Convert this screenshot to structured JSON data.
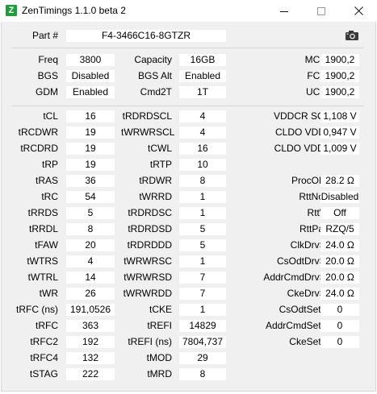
{
  "window": {
    "title": "ZenTimings 1.1.0 beta 2",
    "icon_letter": "Z",
    "icon_color": "#1e9e3a"
  },
  "part": {
    "label": "Part #",
    "value": "F4-3466C16-8GTZR"
  },
  "top_rows": [
    [
      {
        "label": "Freq",
        "value": "3800"
      },
      {
        "label": "Capacity",
        "value": "16GB"
      },
      {
        "label": "MCLK",
        "value": "1900,2"
      }
    ],
    [
      {
        "label": "BGS",
        "value": "Disabled"
      },
      {
        "label": "BGS Alt",
        "value": "Enabled"
      },
      {
        "label": "FCLK",
        "value": "1900,2"
      }
    ],
    [
      {
        "label": "GDM",
        "value": "Enabled"
      },
      {
        "label": "Cmd2T",
        "value": "1T"
      },
      {
        "label": "UCLK",
        "value": "1900,2"
      }
    ]
  ],
  "col1": [
    {
      "label": "tCL",
      "value": "16"
    },
    {
      "label": "tRCDWR",
      "value": "19"
    },
    {
      "label": "tRCDRD",
      "value": "19"
    },
    {
      "label": "tRP",
      "value": "19"
    },
    {
      "label": "tRAS",
      "value": "36"
    },
    {
      "label": "tRC",
      "value": "54"
    },
    {
      "label": "tRRDS",
      "value": "5"
    },
    {
      "label": "tRRDL",
      "value": "8"
    },
    {
      "label": "tFAW",
      "value": "20"
    },
    {
      "label": "tWTRS",
      "value": "4"
    },
    {
      "label": "tWTRL",
      "value": "14"
    },
    {
      "label": "tWR",
      "value": "26"
    },
    {
      "label": "tRFC (ns)",
      "value": "191,0526"
    },
    {
      "label": "tRFC",
      "value": "363"
    },
    {
      "label": "tRFC2",
      "value": "192"
    },
    {
      "label": "tRFC4",
      "value": "132"
    },
    {
      "label": "tSTAG",
      "value": "222"
    }
  ],
  "col2": [
    {
      "label": "tRDRDSCL",
      "value": "4"
    },
    {
      "label": "tWRWRSCL",
      "value": "4"
    },
    {
      "label": "tCWL",
      "value": "16"
    },
    {
      "label": "tRTP",
      "value": "10"
    },
    {
      "label": "tRDWR",
      "value": "8"
    },
    {
      "label": "tWRRD",
      "value": "1"
    },
    {
      "label": "tRDRDSC",
      "value": "1"
    },
    {
      "label": "tRDRDSD",
      "value": "5"
    },
    {
      "label": "tRDRDDD",
      "value": "5"
    },
    {
      "label": "tWRWRSC",
      "value": "1"
    },
    {
      "label": "tWRWRSD",
      "value": "7"
    },
    {
      "label": "tWRWRDD",
      "value": "7"
    },
    {
      "label": "tCKE",
      "value": "1"
    },
    {
      "label": "tREFI",
      "value": "14829"
    },
    {
      "label": "tREFI (ns)",
      "value": "7804,737"
    },
    {
      "label": "tMOD",
      "value": "29"
    },
    {
      "label": "tMRD",
      "value": "8"
    }
  ],
  "col3": [
    {
      "label": "VDDCR SOC",
      "value": "1,108 V"
    },
    {
      "label": "CLDO VDDP",
      "value": "0,947 V"
    },
    {
      "label": "CLDO VDDG",
      "value": "1,009 V"
    },
    null,
    {
      "label": "ProcODT",
      "value": "28.2 Ω"
    },
    {
      "label": "RttNom",
      "value": "Disabled"
    },
    {
      "label": "RttWr",
      "value": "Off"
    },
    {
      "label": "RttPark",
      "value": "RZQ/5"
    },
    {
      "label": "ClkDrvStr",
      "value": "24.0 Ω"
    },
    {
      "label": "CsOdtDrvStr",
      "value": "20.0 Ω"
    },
    {
      "label": "AddrCmdDrvStr",
      "value": "20.0 Ω"
    },
    {
      "label": "CkeDrvStr",
      "value": "24.0 Ω"
    },
    {
      "label": "CsOdtSetup",
      "value": "0"
    },
    {
      "label": "AddrCmdSetup",
      "value": "0"
    },
    {
      "label": "CkeSetup",
      "value": "0"
    },
    null,
    null
  ],
  "icons": {
    "minimize": "minimize-icon",
    "maximize": "maximize-icon",
    "close": "close-icon",
    "screenshot": "camera-icon"
  }
}
